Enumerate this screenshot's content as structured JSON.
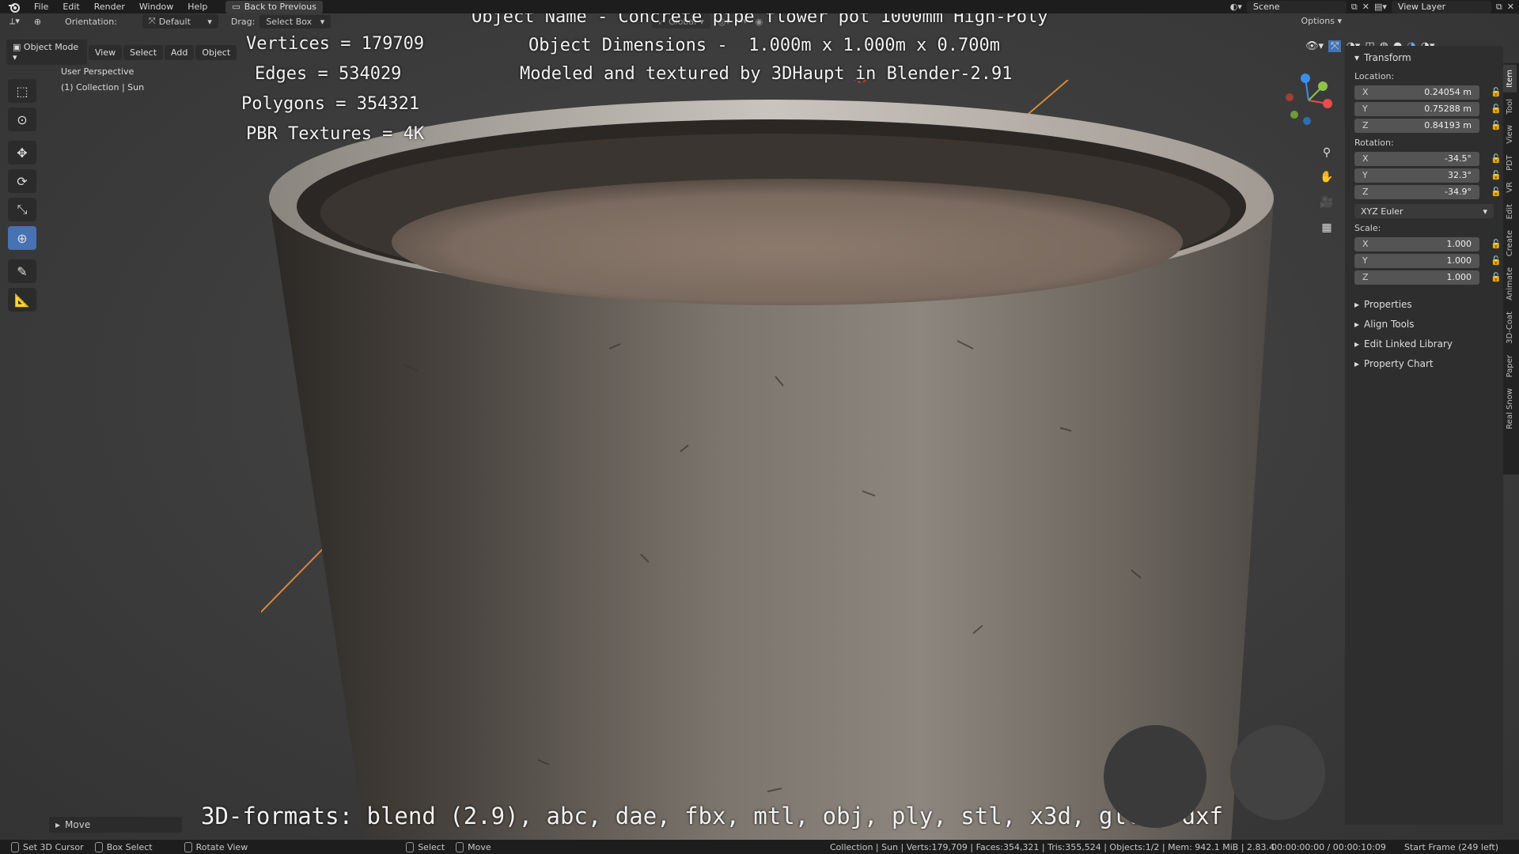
{
  "menu": {
    "items": [
      "File",
      "Edit",
      "Render",
      "Window",
      "Help"
    ],
    "back_button": "Back to Previous",
    "scene_label": "Scene",
    "view_layer_label": "View Layer"
  },
  "viewport_header": {
    "orientation_label": "Orientation:",
    "orientation_value": "Default",
    "drag_label": "Drag:",
    "drag_value": "Select Box",
    "transform_orientation": "Global",
    "options_label": "Options"
  },
  "mode_header": {
    "mode": "Object Mode",
    "menus": [
      "View",
      "Select",
      "Add",
      "Object"
    ]
  },
  "viewport_info": {
    "perspective": "User Perspective",
    "collection": "(1) Collection | Sun"
  },
  "overlay": {
    "vertices": "Vertices = 179709",
    "edges": "Edges = 534029",
    "polygons": "Polygons = 354321",
    "textures": "PBR Textures = 4K",
    "object_name": "Object Name - Concrete pipe flower pot 1000mm High-Poly",
    "dimensions": "Object Dimensions -  1.000m x 1.000m x 0.700m",
    "credits": "Modeled and textured by 3DHaupt in Blender-2.91",
    "formats": "3D-formats: blend (2.9), abc, dae, fbx, mtl, obj, ply, stl, x3d, gltf, dxf"
  },
  "npanel": {
    "title": "Transform",
    "location_label": "Location:",
    "location": [
      {
        "axis": "X",
        "value": "0.24054 m"
      },
      {
        "axis": "Y",
        "value": "0.75288 m"
      },
      {
        "axis": "Z",
        "value": "0.84193 m"
      }
    ],
    "rotation_label": "Rotation:",
    "rotation": [
      {
        "axis": "X",
        "value": "-34.5°"
      },
      {
        "axis": "Y",
        "value": "32.3°"
      },
      {
        "axis": "Z",
        "value": "-34.9°"
      }
    ],
    "rotation_mode": "XYZ Euler",
    "scale_label": "Scale:",
    "scale": [
      {
        "axis": "X",
        "value": "1.000"
      },
      {
        "axis": "Y",
        "value": "1.000"
      },
      {
        "axis": "Z",
        "value": "1.000"
      }
    ],
    "collapsed_sections": [
      "Properties",
      "Align Tools",
      "Edit Linked Library",
      "Property Chart"
    ],
    "tabs": [
      "Item",
      "Tool",
      "View",
      "PDT",
      "VR",
      "Edit",
      "Create",
      "Animate",
      "3D-Coat",
      "Paper",
      "Real Snow"
    ]
  },
  "operator_panel": {
    "label": "Move"
  },
  "status": {
    "set_cursor": "Set 3D Cursor",
    "box_select": "Box Select",
    "rotate_view": "Rotate View",
    "select": "Select",
    "move": "Move",
    "stats": "Collection | Sun | Verts:179,709 | Faces:354,321 | Tris:355,524 | Objects:1/2 | Mem: 942.1 MiB | 2.83.4",
    "time": "00:00:00:00 / 00:00:10:09",
    "frame": "Start Frame (249 left)"
  },
  "colors": {
    "active_tool": "#4772b3",
    "gizmo_x": "#e84c4c",
    "gizmo_y": "#8bc34a",
    "gizmo_z": "#3b8fe8",
    "axis_line": "#d9883a"
  }
}
